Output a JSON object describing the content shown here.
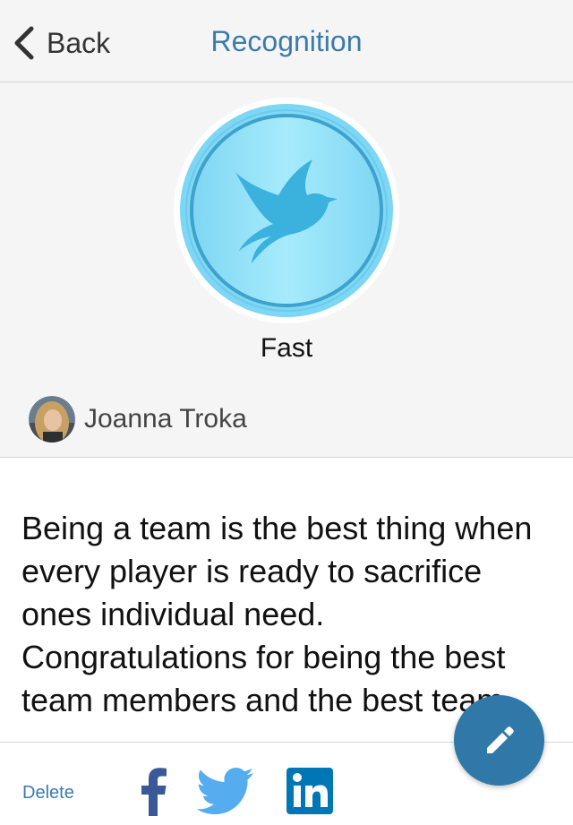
{
  "nav": {
    "back_label": "Back",
    "title": "Recognition"
  },
  "badge": {
    "name": "Fast",
    "icon": "dove-icon",
    "colors": {
      "outer": "#7fd8f6",
      "inner": "#9fe6fb",
      "ring": "#3aa0cc",
      "bird": "#3bb0de"
    }
  },
  "author": {
    "name": "Joanna Troka"
  },
  "message": {
    "text": "Being a team is the best thing when every player is ready to sacrifice ones individual need. Congratulations for being the best team members and the best team."
  },
  "footer": {
    "delete_label": "Delete",
    "share": [
      {
        "name": "facebook-icon",
        "color": "#3b5998"
      },
      {
        "name": "twitter-icon",
        "color": "#55acee"
      },
      {
        "name": "linkedin-icon",
        "color": "#0077b5"
      }
    ]
  },
  "fab": {
    "icon": "pencil-icon",
    "color": "#2f78a7"
  },
  "colors": {
    "accent": "#3b7bab",
    "panel": "#f5f5f5"
  }
}
